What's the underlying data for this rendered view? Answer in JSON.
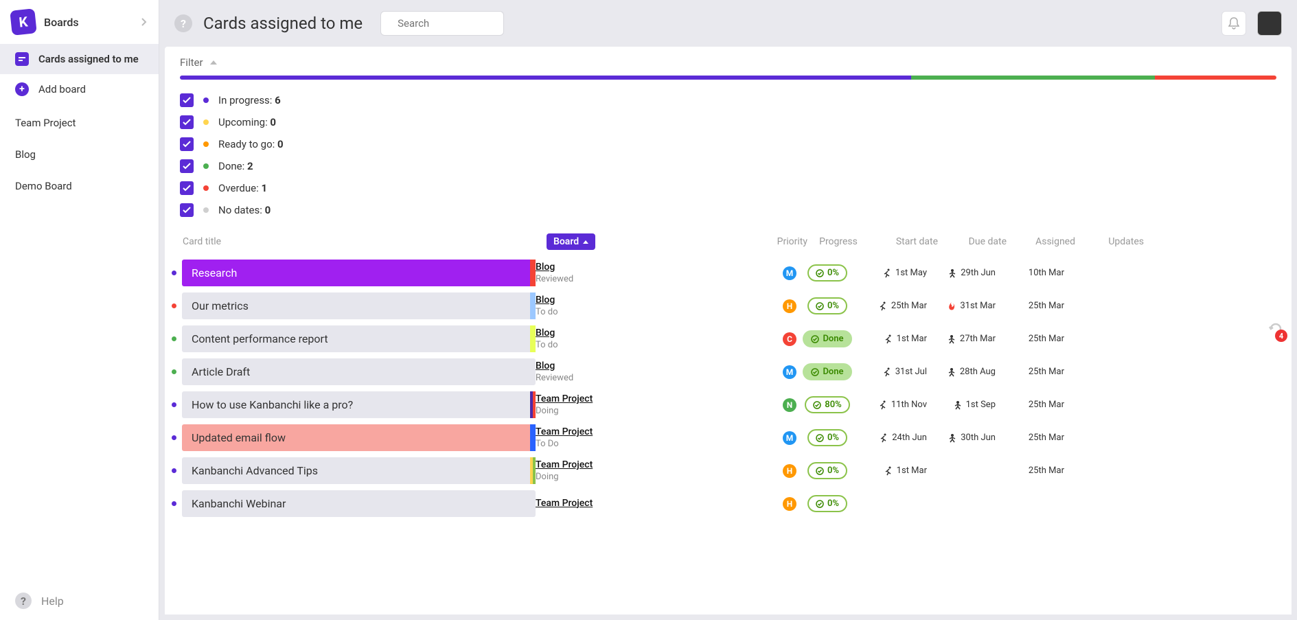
{
  "sidebar": {
    "header": "Boards",
    "items": [
      {
        "label": "Cards assigned to me",
        "active": true
      },
      {
        "label": "Add board"
      }
    ],
    "boards": [
      "Team Project",
      "Blog",
      "Demo Board"
    ],
    "help": "Help"
  },
  "header": {
    "title": "Cards assigned to me",
    "search_placeholder": "Search"
  },
  "filter_label": "Filter",
  "status_segments": [
    {
      "color": "#5b2bd6",
      "flex": 6
    },
    {
      "color": "#4caf50",
      "flex": 2
    },
    {
      "color": "#f44336",
      "flex": 1
    }
  ],
  "filters": [
    {
      "color": "#5b2bd6",
      "label": "In progress:",
      "count": "6"
    },
    {
      "color": "#ffd54f",
      "label": "Upcoming:",
      "count": "0"
    },
    {
      "color": "#ff9800",
      "label": "Ready to go:",
      "count": "0"
    },
    {
      "color": "#4caf50",
      "label": "Done:",
      "count": "2"
    },
    {
      "color": "#f44336",
      "label": "Overdue:",
      "count": "1"
    },
    {
      "color": "#cfcfcf",
      "label": "No dates:",
      "count": "0"
    }
  ],
  "columns": {
    "title": "Card title",
    "board": "Board",
    "priority": "Priority",
    "progress": "Progress",
    "start": "Start date",
    "due": "Due date",
    "assigned": "Assigned",
    "updates": "Updates"
  },
  "rows": [
    {
      "dot": "#5b2bd6",
      "title": "Research",
      "bg": "#a020f0",
      "fg": "#fff",
      "edges": [
        "#f44336"
      ],
      "board": "Blog",
      "sub": "Reviewed",
      "prio": "M",
      "prio_color": "#2196f3",
      "prog": "0%",
      "start": "1st May",
      "start_ic": "run",
      "due": "29th Jun",
      "due_ic": "person",
      "assigned": "10th Mar"
    },
    {
      "dot": "#f44336",
      "title": "Our metrics",
      "bg": "#e6e6ed",
      "fg": "#333",
      "edges": [
        "#9cc8ff"
      ],
      "board": "Blog",
      "sub": "To do",
      "prio": "H",
      "prio_color": "#ff9800",
      "prog": "0%",
      "start": "25th Mar",
      "start_ic": "run",
      "due": "31st Mar",
      "due_ic": "fire",
      "assigned": "25th Mar"
    },
    {
      "dot": "#4caf50",
      "title": "Content performance report",
      "bg": "#e6e6ed",
      "fg": "#333",
      "edges": [
        "#e8ff59"
      ],
      "board": "Blog",
      "sub": "To do",
      "prio": "C",
      "prio_color": "#f44336",
      "prog": "Done",
      "start": "1st Mar",
      "start_ic": "run",
      "due": "27th Mar",
      "due_ic": "person",
      "assigned": "25th Mar"
    },
    {
      "dot": "#4caf50",
      "title": "Article Draft",
      "bg": "#e6e6ed",
      "fg": "#333",
      "edges": [],
      "board": "Blog",
      "sub": "Reviewed",
      "prio": "M",
      "prio_color": "#2196f3",
      "prog": "Done",
      "start": "31st Jul",
      "start_ic": "run",
      "due": "28th Aug",
      "due_ic": "person",
      "assigned": "25th Mar"
    },
    {
      "dot": "#5b2bd6",
      "title": "How to use Kanbanchi like a pro?",
      "bg": "#e6e6ed",
      "fg": "#333",
      "edges": [
        "#4e2aa8",
        "#f44336"
      ],
      "board": "Team Project",
      "sub": "Doing",
      "prio": "N",
      "prio_color": "#4caf50",
      "prog": "80%",
      "start": "11th Nov",
      "start_ic": "run",
      "due": "1st Sep",
      "due_ic": "person",
      "assigned": "25th Mar"
    },
    {
      "dot": "#5b2bd6",
      "title": "Updated email flow",
      "bg": "#f8a6a0",
      "fg": "#333",
      "edges": [
        "#2962ff"
      ],
      "board": "Team Project",
      "sub": "To Do",
      "prio": "M",
      "prio_color": "#2196f3",
      "prog": "0%",
      "start": "24th Jun",
      "start_ic": "run",
      "due": "30th Jun",
      "due_ic": "person",
      "assigned": "25th Mar"
    },
    {
      "dot": "#5b2bd6",
      "title": "Kanbanchi Advanced Tips",
      "bg": "#e6e6ed",
      "fg": "#333",
      "edges": [
        "#ffd54f",
        "#8bc34a"
      ],
      "board": "Team Project",
      "sub": "Doing",
      "prio": "H",
      "prio_color": "#ff9800",
      "prog": "0%",
      "start": "1st Mar",
      "start_ic": "run",
      "due": "",
      "due_ic": "",
      "assigned": "25th Mar"
    },
    {
      "dot": "#5b2bd6",
      "title": "Kanbanchi Webinar",
      "bg": "#e6e6ed",
      "fg": "#333",
      "edges": [],
      "board": "Team Project",
      "sub": "",
      "prio": "H",
      "prio_color": "#ff9800",
      "prog": "0%",
      "start": "",
      "start_ic": "",
      "due": "",
      "due_ic": "",
      "assigned": ""
    }
  ],
  "updates_badge": "4"
}
